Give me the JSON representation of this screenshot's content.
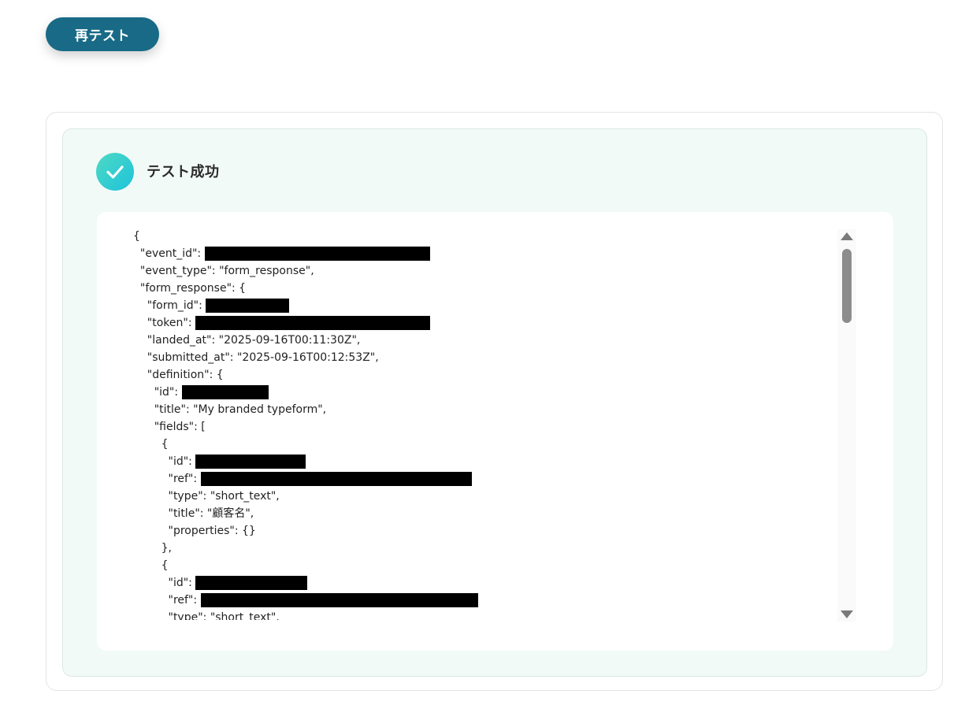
{
  "toolbar": {
    "retest_label": "再テスト"
  },
  "result": {
    "status_label": "テスト成功",
    "status_icon": "check-circle-icon",
    "accent_color": "#1cc3dc"
  },
  "json_output": {
    "lines": [
      {
        "text": "{",
        "redacted": false
      },
      {
        "text": "  \"event_id\": ",
        "redacted": true
      },
      {
        "text": "  \"event_type\": \"form_response\",",
        "redacted": false
      },
      {
        "text": "  \"form_response\": {",
        "redacted": false
      },
      {
        "text": "    \"form_id\": ",
        "redacted": true
      },
      {
        "text": "    \"token\": ",
        "redacted": true
      },
      {
        "text": "    \"landed_at\": \"2025-09-16T00:11:30Z\",",
        "redacted": false
      },
      {
        "text": "    \"submitted_at\": \"2025-09-16T00:12:53Z\",",
        "redacted": false
      },
      {
        "text": "    \"definition\": {",
        "redacted": false
      },
      {
        "text": "      \"id\": ",
        "redacted": true
      },
      {
        "text": "      \"title\": \"My branded typeform\",",
        "redacted": false
      },
      {
        "text": "      \"fields\": [",
        "redacted": false
      },
      {
        "text": "        {",
        "redacted": false
      },
      {
        "text": "          \"id\": ",
        "redacted": true
      },
      {
        "text": "          \"ref\": ",
        "redacted": true
      },
      {
        "text": "          \"type\": \"short_text\",",
        "redacted": false
      },
      {
        "text": "          \"title\": \"顧客名\",",
        "redacted": false
      },
      {
        "text": "          \"properties\": {}",
        "redacted": false
      },
      {
        "text": "        },",
        "redacted": false
      },
      {
        "text": "        {",
        "redacted": false
      },
      {
        "text": "          \"id\": ",
        "redacted": true
      },
      {
        "text": "          \"ref\": ",
        "redacted": true
      },
      {
        "text": "          \"type\": \"short_text\",",
        "redacted": false
      }
    ]
  }
}
